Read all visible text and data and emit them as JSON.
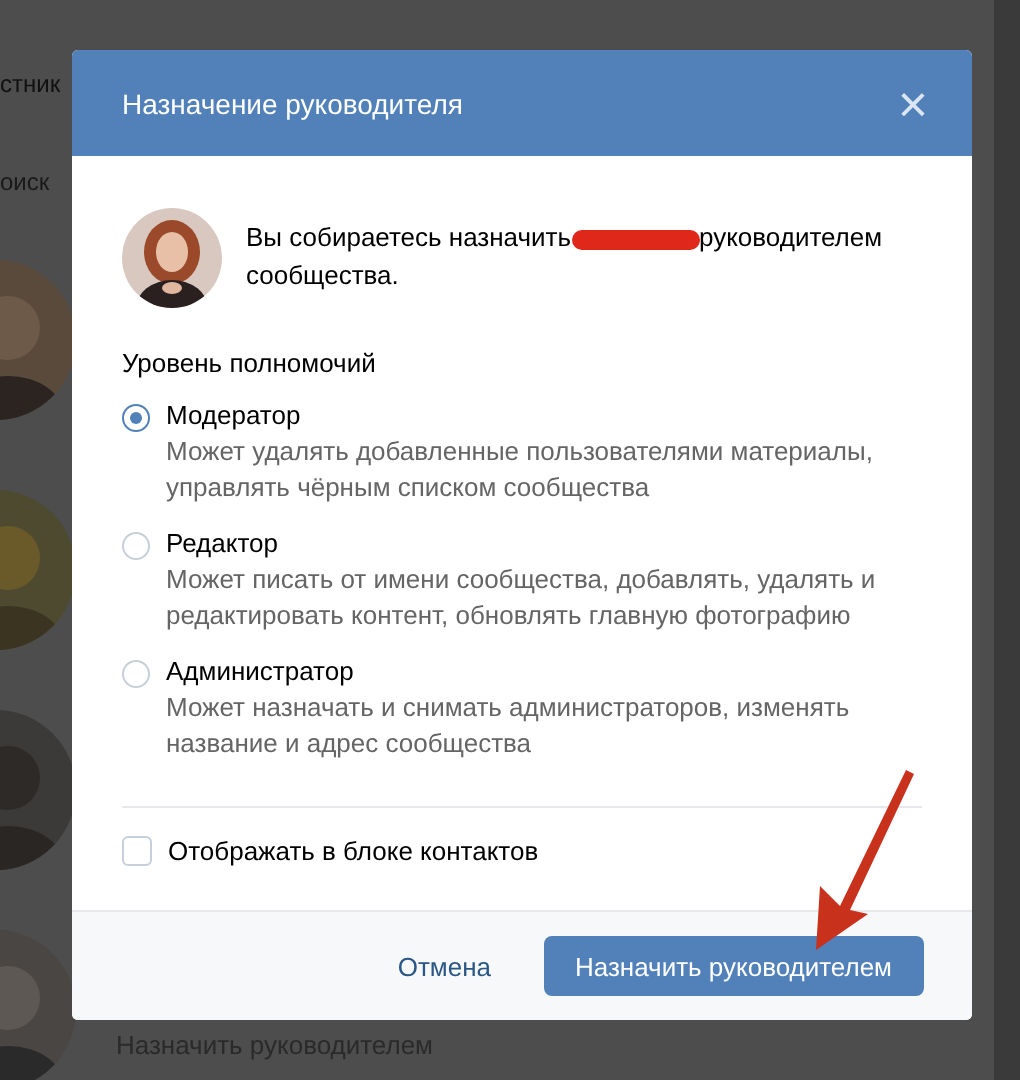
{
  "background": {
    "heading": "стник",
    "search": {
      "placeholder": "оиск"
    },
    "link": "Назначить руководителем"
  },
  "dialog": {
    "title": "Назначение руководителя",
    "close": "×",
    "intro": {
      "before": "Вы собираетесь назначить",
      "after": "руководителем",
      "end": "сообщества."
    },
    "section_title": "Уровень полномочий",
    "roles": [
      {
        "label": "Модератор",
        "description": "Может удалять добавленные пользователями материалы, управлять чёрным списком сообщества",
        "selected": true
      },
      {
        "label": "Редактор",
        "description": "Может писать от имени сообщества, добавлять, удалять и редактировать контент, обновлять главную фотографию",
        "selected": false
      },
      {
        "label": "Администратор",
        "description": "Может назначать и снимать администраторов, изменять название и адрес сообщества",
        "selected": false
      }
    ],
    "contacts_checkbox": {
      "label": "Отображать в блоке контактов",
      "checked": false
    },
    "buttons": {
      "cancel": "Отмена",
      "confirm": "Назначить руководителем"
    }
  }
}
